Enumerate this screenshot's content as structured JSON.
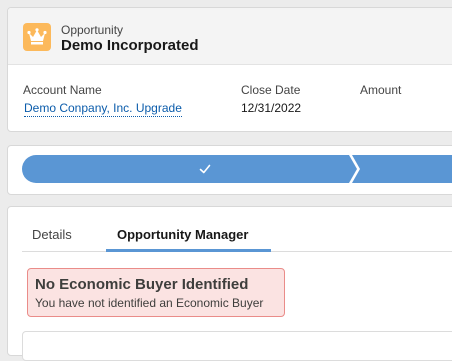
{
  "record_header": {
    "object_type": "Opportunity",
    "record_name": "Demo Incorporated",
    "icon": "crown-icon",
    "icon_color": "#fcb95b"
  },
  "highlights": [
    {
      "label": "Account Name",
      "value": "Demo Conpany, Inc. Upgrade",
      "is_link": true
    },
    {
      "label": "Close Date",
      "value": "12/31/2022",
      "is_link": false
    },
    {
      "label": "Amount",
      "value": "",
      "is_link": false
    }
  ],
  "path": {
    "steps": [
      {
        "state": "complete",
        "icon": "check-icon"
      },
      {
        "state": "complete"
      }
    ],
    "color": "#5a96d4"
  },
  "tabs": [
    {
      "label": "Details",
      "active": false
    },
    {
      "label": "Opportunity Manager",
      "active": true
    }
  ],
  "alert": {
    "title": "No Economic Buyer Identified",
    "message": "You have not identified an Economic Buyer",
    "bg_color": "#fbe3e2",
    "border_color": "#ea8c89"
  }
}
